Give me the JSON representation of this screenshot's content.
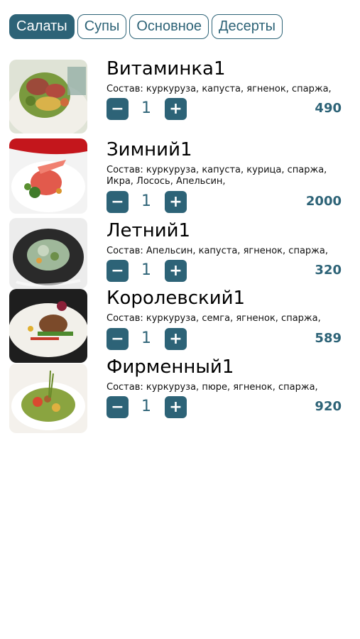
{
  "tabs": [
    {
      "label": "Салаты",
      "active": true
    },
    {
      "label": "Супы",
      "active": false
    },
    {
      "label": "Основное",
      "active": false
    },
    {
      "label": "Десерты",
      "active": false
    }
  ],
  "colors": {
    "accent": "#2d6377",
    "background": "#ffffff"
  },
  "icons": {
    "minus": "minus-icon",
    "plus": "plus-icon"
  },
  "items": [
    {
      "name": "Витаминка1",
      "ingredients": "Состав: куркуруза, капуста, ягненок, спаржа,",
      "quantity": "1",
      "price": "490",
      "minus_label": "−",
      "plus_label": "+"
    },
    {
      "name": "Зимний1",
      "ingredients": "Состав: куркуруза, капуста, курица, спаржа, Икра, Лосось, Апельсин,",
      "quantity": "1",
      "price": "2000",
      "minus_label": "−",
      "plus_label": "+"
    },
    {
      "name": "Летний1",
      "ingredients": "Состав: Апельсин, капуста, ягненок, спаржа,",
      "quantity": "1",
      "price": "320",
      "minus_label": "−",
      "plus_label": "+"
    },
    {
      "name": "Королевский1",
      "ingredients": "Состав: куркуруза, семга, ягненок, спаржа,",
      "quantity": "1",
      "price": "589",
      "minus_label": "−",
      "plus_label": "+"
    },
    {
      "name": "Фирменный1",
      "ingredients": "Состав: куркуруза, пюре, ягненок, спаржа,",
      "quantity": "1",
      "price": "920",
      "minus_label": "−",
      "plus_label": "+"
    }
  ]
}
